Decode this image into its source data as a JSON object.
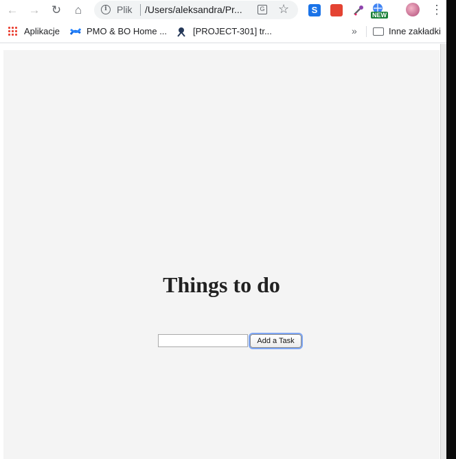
{
  "browser": {
    "url_scheme_label": "Plik",
    "url": "/Users/aleksandra/Pr...",
    "new_badge": "NEW"
  },
  "bookmarks": {
    "apps": "Aplikacje",
    "items": [
      "PMO & BO Home ...",
      "[PROJECT-301] tr..."
    ],
    "more": "»",
    "other": "Inne zakładki"
  },
  "page": {
    "heading": "Things to do",
    "input_value": "",
    "add_button": "Add a Task"
  },
  "colors": {
    "page_bg": "#f4f4f4",
    "heading": "#222222",
    "focus_ring": "#7ea6f3"
  },
  "icons": [
    "back-icon",
    "forward-icon",
    "reload-icon",
    "home-icon",
    "info-icon",
    "translate-icon",
    "star-icon",
    "apps-icon",
    "confluence-icon",
    "jira-icon",
    "folder-icon",
    "menu-icon"
  ]
}
